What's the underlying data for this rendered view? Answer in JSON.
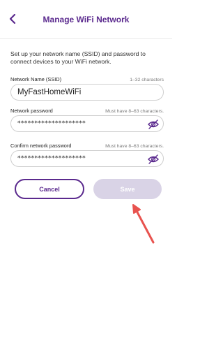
{
  "header": {
    "title": "Manage WiFi Network",
    "back_icon": "chevron-left-icon"
  },
  "intro_text": "Set up your network name (SSID) and password to connect devices to your WiFi network.",
  "ssid": {
    "label": "Network Name (SSID)",
    "hint": "1–32 characters",
    "value": "MyFastHomeWiFi"
  },
  "password": {
    "label": "Network password",
    "hint": "Must have 8–63 characters.",
    "value": "********************",
    "icon": "eye-off-icon"
  },
  "confirm_password": {
    "label": "Confirm network password",
    "hint": "Must have 8–63 characters.",
    "value": "********************",
    "icon": "eye-off-icon"
  },
  "buttons": {
    "cancel": "Cancel",
    "save": "Save"
  },
  "colors": {
    "brand": "#5b2a8e",
    "save_disabled": "#d9d3e6",
    "annotation_arrow": "#e8534f"
  }
}
